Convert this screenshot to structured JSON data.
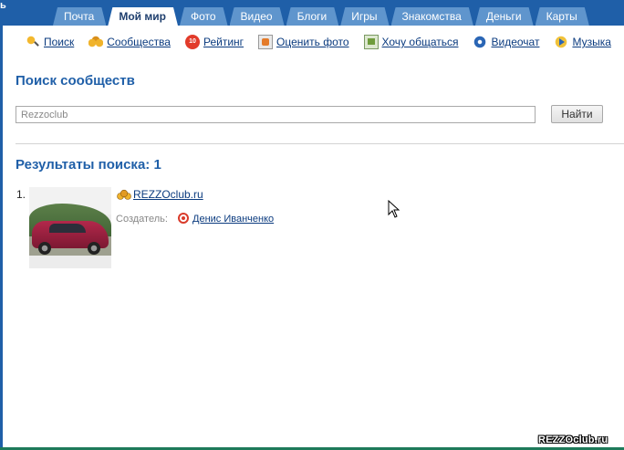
{
  "header": {
    "brand_fragment": "ь",
    "tabs": [
      {
        "label": "Почта",
        "active": false
      },
      {
        "label": "Мой мир",
        "active": true
      },
      {
        "label": "Фото",
        "active": false
      },
      {
        "label": "Видео",
        "active": false
      },
      {
        "label": "Блоги",
        "active": false
      },
      {
        "label": "Игры",
        "active": false
      },
      {
        "label": "Знакомства",
        "active": false
      },
      {
        "label": "Деньги",
        "active": false
      },
      {
        "label": "Карты",
        "active": false
      }
    ]
  },
  "subnav": {
    "items": [
      {
        "label": "Поиск",
        "icon": "search-icon"
      },
      {
        "label": "Сообщества",
        "icon": "communities-icon"
      },
      {
        "label": "Рейтинг",
        "icon": "rating-icon",
        "icon_text": "10"
      },
      {
        "label": "Оценить фото",
        "icon": "rate-photo-icon"
      },
      {
        "label": "Хочу общаться",
        "icon": "chat-icon"
      },
      {
        "label": "Видеочат",
        "icon": "videochat-icon"
      },
      {
        "label": "Музыка",
        "icon": "music-icon"
      }
    ]
  },
  "search": {
    "title": "Поиск сообществ",
    "input_value": "Rezzoclub",
    "button_label": "Найти"
  },
  "results": {
    "title": "Результаты поиска: 1",
    "items": [
      {
        "number": "1.",
        "name": "REZZOclub.ru",
        "creator_label": "Создатель:",
        "creator_name": "Денис Иванченко"
      }
    ]
  },
  "watermark": "REZZOclub.ru",
  "colors": {
    "header_blue": "#1f5fa8",
    "tab_blue": "#5f95cd",
    "link_blue": "#0b3b7f",
    "heading_blue": "#1f5fa8"
  }
}
